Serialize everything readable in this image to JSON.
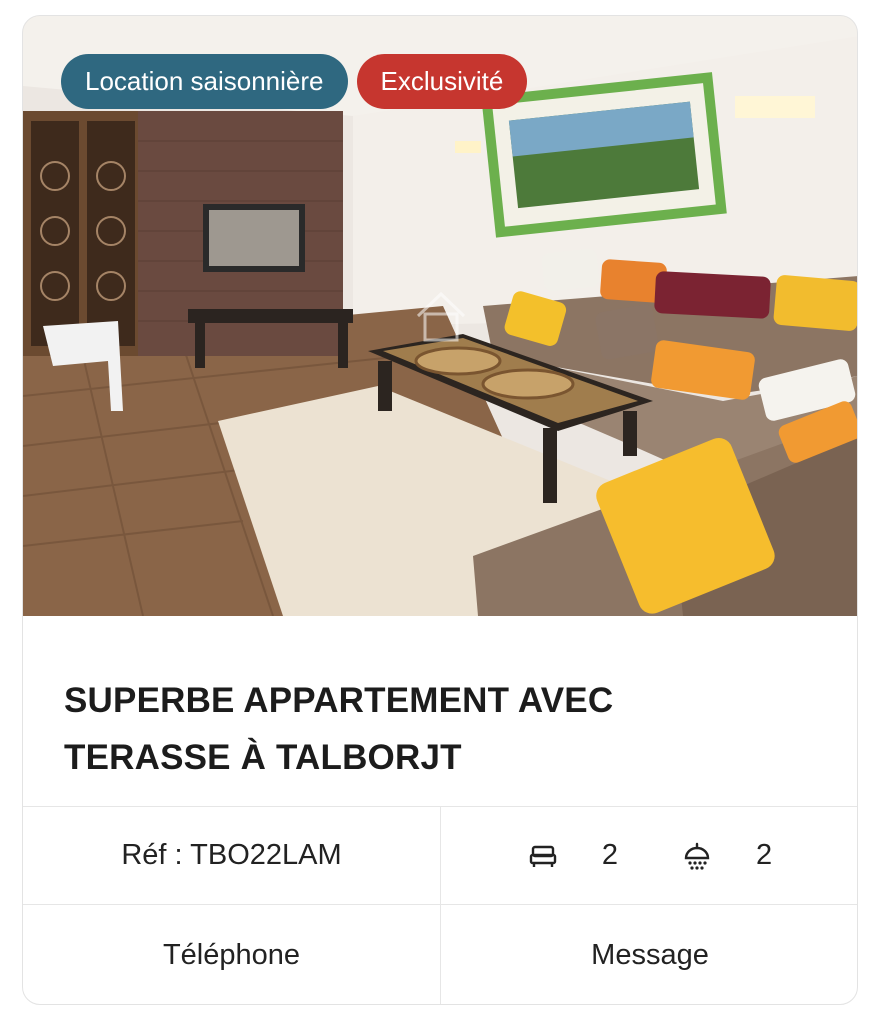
{
  "listing": {
    "badges": {
      "type": "Location saisonnière",
      "exclusive": "Exclusivité"
    },
    "title": "SUPERBE APPARTEMENT AVEC TERASSE À TALBORJT",
    "reference": "Réf : TBO22LAM",
    "bedrooms": "2",
    "bathrooms": "2",
    "icons": {
      "bedrooms": "bed-icon",
      "bathrooms": "shower-icon"
    },
    "colors": {
      "type_badge": "#2f6880",
      "exclusive_badge": "#c6362f"
    }
  },
  "actions": {
    "phone_label": "Téléphone",
    "message_label": "Message"
  }
}
